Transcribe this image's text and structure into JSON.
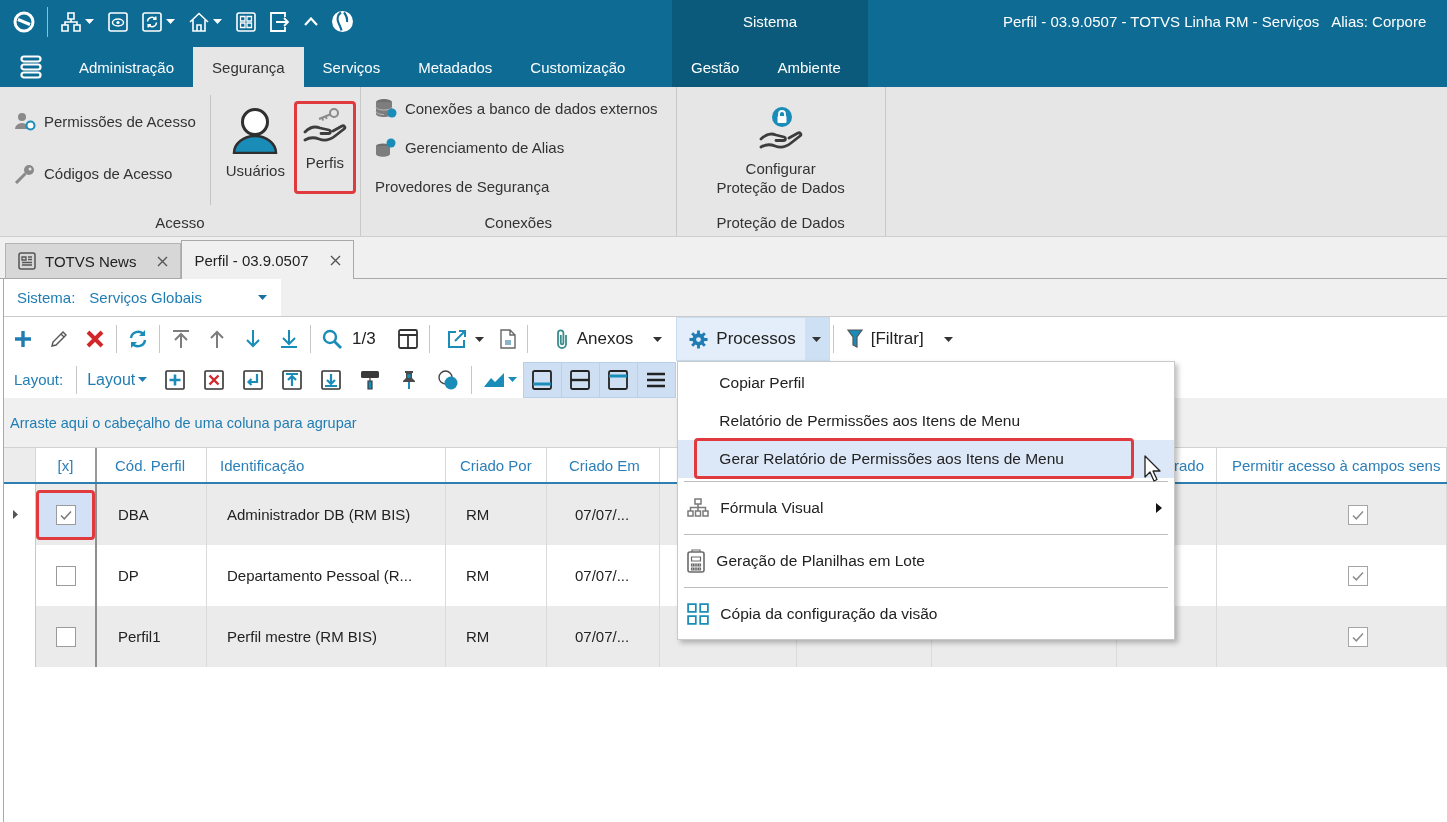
{
  "title_bar": {
    "context_group": "Sistema",
    "document": "Perfil - 03.9.0507 - TOTVS Linha RM - Serviços",
    "alias": "Alias: Corpore"
  },
  "ribbon_tabs": [
    {
      "label": "Administração",
      "selected": false,
      "contextual": false
    },
    {
      "label": "Segurança",
      "selected": true,
      "contextual": false
    },
    {
      "label": "Serviços",
      "selected": false,
      "contextual": false
    },
    {
      "label": "Metadados",
      "selected": false,
      "contextual": false
    },
    {
      "label": "Customização",
      "selected": false,
      "contextual": false
    },
    {
      "label": "Gestão",
      "selected": false,
      "contextual": true
    },
    {
      "label": "Ambiente",
      "selected": false,
      "contextual": true
    }
  ],
  "ribbon_groups": [
    {
      "label": "Acesso",
      "items": [
        {
          "kind": "small",
          "label": "Permissões de Acesso",
          "outlined": false
        },
        {
          "kind": "small",
          "label": "Códigos de Acesso",
          "outlined": false
        },
        {
          "kind": "large",
          "label": "Usuários",
          "outlined": false
        },
        {
          "kind": "large",
          "label": "Perfis",
          "outlined": true
        }
      ]
    },
    {
      "label": "Conexões",
      "items": [
        {
          "kind": "small",
          "label": "Conexões a banco de dados externos",
          "outlined": false
        },
        {
          "kind": "small",
          "label": "Gerenciamento de Alias",
          "outlined": false
        },
        {
          "kind": "plain",
          "label": "Provedores de Segurança",
          "outlined": false
        }
      ]
    },
    {
      "label": "Proteção de Dados",
      "items": [
        {
          "kind": "large",
          "label": "Configurar Proteção de Dados",
          "outlined": false
        }
      ]
    }
  ],
  "document_tabs": [
    {
      "label": "TOTVS News",
      "selected": false
    },
    {
      "label": "Perfil - 03.9.0507",
      "selected": true
    }
  ],
  "system_selector": {
    "label": "Sistema:",
    "value": "Serviços Globais"
  },
  "toolbar": {
    "record_position": "1/3",
    "attachments": "Anexos",
    "processes": {
      "label": "Processos",
      "open": true
    },
    "filter": "[Filtrar]"
  },
  "layout_bar": {
    "label": "Layout:",
    "dropdown": "Layout"
  },
  "group_panel": {
    "hint": "Arraste aqui o cabeçalho de uma coluna para agrupar"
  },
  "grid": {
    "columns": [
      "[x]",
      "Cód. Perfil",
      "Identificação",
      "Criado Por",
      "Criado Em",
      null,
      null,
      null,
      "rado",
      "Permitir acesso à campos sens"
    ],
    "rows": [
      {
        "selected": true,
        "checked": true,
        "outlined": true,
        "code": "DBA",
        "identification": "Administrador DB (RM BIS)",
        "created_by": "RM",
        "created_at": "07/07/...",
        "allow_access": true
      },
      {
        "selected": false,
        "checked": false,
        "outlined": false,
        "code": "DP",
        "identification": "Departamento Pessoal (R...",
        "created_by": "RM",
        "created_at": "07/07/...",
        "allow_access": true
      },
      {
        "selected": false,
        "checked": false,
        "outlined": false,
        "code": "Perfil1",
        "identification": "Perfil mestre (RM BIS)",
        "created_by": "RM",
        "created_at": "07/07/...",
        "allow_access": true
      }
    ]
  },
  "process_menu": [
    {
      "kind": "text",
      "label": "Copiar Perfil",
      "highlighted": false,
      "outlined": false
    },
    {
      "kind": "text",
      "label": "Relatório de Permissões aos Itens de Menu",
      "highlighted": false,
      "outlined": false
    },
    {
      "kind": "text",
      "label": "Gerar Relatório de Permissões aos Itens de Menu",
      "highlighted": true,
      "outlined": true
    },
    {
      "kind": "separator"
    },
    {
      "kind": "submenu",
      "label": "Fórmula Visual",
      "highlighted": false,
      "outlined": false
    },
    {
      "kind": "separator"
    },
    {
      "kind": "icon",
      "label": "Geração de Planilhas em Lote",
      "highlighted": false,
      "outlined": false
    },
    {
      "kind": "separator"
    },
    {
      "kind": "icon",
      "label": "Cópia da configuração da visão",
      "highlighted": false,
      "outlined": false
    }
  ]
}
